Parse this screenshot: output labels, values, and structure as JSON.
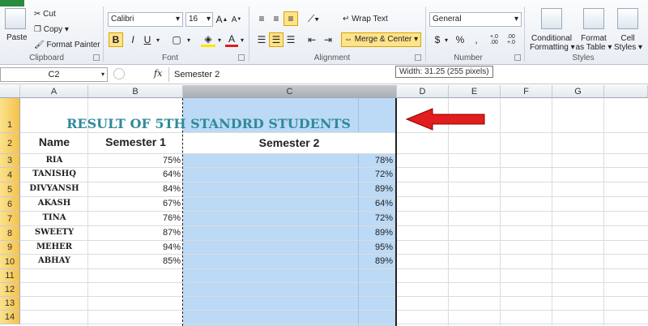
{
  "ribbon": {
    "clipboard": {
      "label": "Clipboard",
      "paste": "Paste",
      "cut": "Cut",
      "copy": "Copy",
      "format_painter": "Format Painter"
    },
    "font": {
      "label": "Font",
      "name": "Calibri",
      "size": "16",
      "bold": "B",
      "italic": "I",
      "underline": "U"
    },
    "alignment": {
      "label": "Alignment",
      "wrap_text": "Wrap Text",
      "merge_center": "Merge & Center"
    },
    "number": {
      "label": "Number",
      "format": "General",
      "currency": "$",
      "percent": "%",
      "comma": ",",
      "inc_dec": "+.0 .00",
      "dec_dec": ".00 +.0"
    },
    "styles": {
      "label": "Styles",
      "conditional": "Conditional",
      "formatting": "Formatting",
      "format_as": "Format",
      "as_table": "as Table",
      "cell": "Cell",
      "cell_styles": "Styles"
    }
  },
  "formula_bar": {
    "name_box": "C2",
    "fx": "fx",
    "value": "Semester 2"
  },
  "tooltip": "Width: 31.25 (255 pixels)",
  "columns": [
    "A",
    "B",
    "C",
    "D",
    "E",
    "F",
    "G"
  ],
  "rows": [
    "1",
    "2",
    "3",
    "4",
    "5",
    "6",
    "7",
    "8",
    "9",
    "10",
    "11",
    "12",
    "13",
    "14"
  ],
  "sheet": {
    "title": "RESULT OF 5TH STANDRD STUDENTS",
    "headers": {
      "name": "Name",
      "sem1": "Semester 1",
      "sem2": "Semester 2"
    },
    "students": [
      {
        "name": "RIA",
        "sem1": "75%",
        "sem2": "78%"
      },
      {
        "name": "TANISHQ",
        "sem1": "64%",
        "sem2": "72%"
      },
      {
        "name": "DIVYANSH",
        "sem1": "84%",
        "sem2": "89%"
      },
      {
        "name": "AKASH",
        "sem1": "67%",
        "sem2": "64%"
      },
      {
        "name": "TINA",
        "sem1": "76%",
        "sem2": "72%"
      },
      {
        "name": "SWEETY",
        "sem1": "87%",
        "sem2": "89%"
      },
      {
        "name": "MEHER",
        "sem1": "94%",
        "sem2": "95%"
      },
      {
        "name": "ABHAY",
        "sem1": "85%",
        "sem2": "89%"
      }
    ]
  },
  "colors": {
    "selection": "#bcd9f5",
    "title": "#2f8a9b",
    "arrow": "#e11d1d",
    "row_header_selected": "#f5c24a"
  }
}
